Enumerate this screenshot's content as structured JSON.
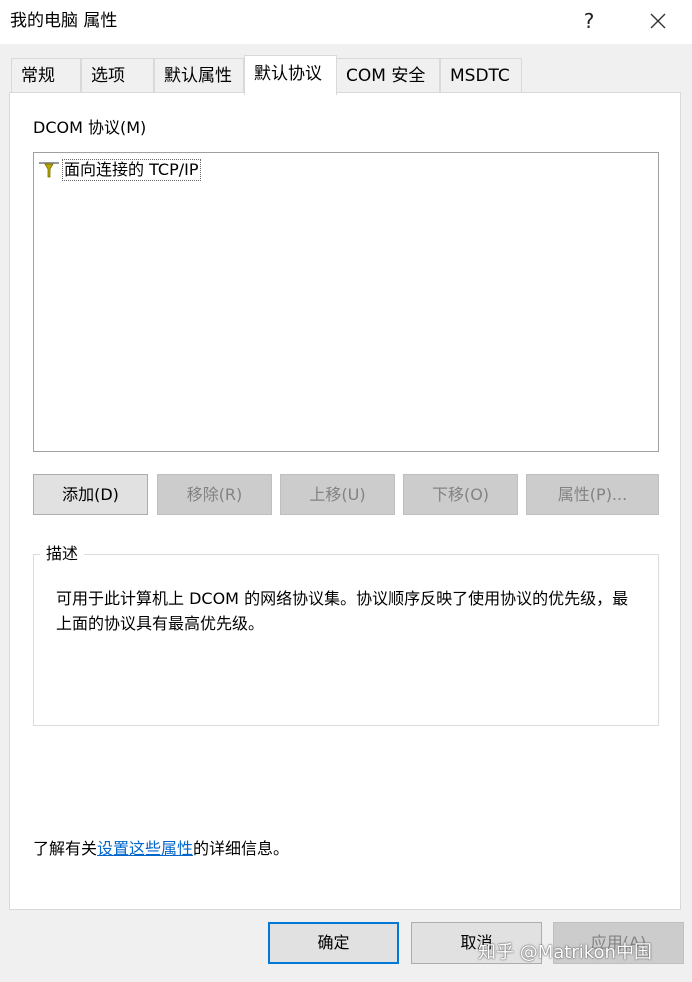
{
  "window": {
    "title": "我的电脑 属性",
    "help_symbol": "?"
  },
  "tabs": [
    {
      "label": "常规",
      "active": false
    },
    {
      "label": "选项",
      "active": false
    },
    {
      "label": "默认属性",
      "active": false
    },
    {
      "label": "默认协议",
      "active": true
    },
    {
      "label": "COM 安全",
      "active": false
    },
    {
      "label": "MSDTC",
      "active": false
    }
  ],
  "panel": {
    "list_label": "DCOM 协议(M)",
    "protocols": [
      {
        "label": "面向连接的 TCP/IP",
        "icon": "network-protocol-icon"
      }
    ],
    "buttons": [
      {
        "label": "添加(D)",
        "enabled": true
      },
      {
        "label": "移除(R)",
        "enabled": false
      },
      {
        "label": "上移(U)",
        "enabled": false
      },
      {
        "label": "下移(O)",
        "enabled": false
      },
      {
        "label": "属性(P)...",
        "enabled": false
      }
    ],
    "description": {
      "legend": "描述",
      "text": "可用于此计算机上 DCOM 的网络协议集。协议顺序反映了使用协议的优先级，最上面的协议具有最高优先级。"
    },
    "info": {
      "prefix": "了解有关",
      "link": "设置这些属性",
      "suffix": "的详细信息。"
    }
  },
  "footer": {
    "ok": "确定",
    "cancel": "取消",
    "apply": "应用(A)"
  },
  "watermark": "知乎 @Matrikon中国",
  "colors": {
    "link": "#0066cc",
    "focus_border": "#0078d7",
    "disabled_text": "#838383"
  }
}
